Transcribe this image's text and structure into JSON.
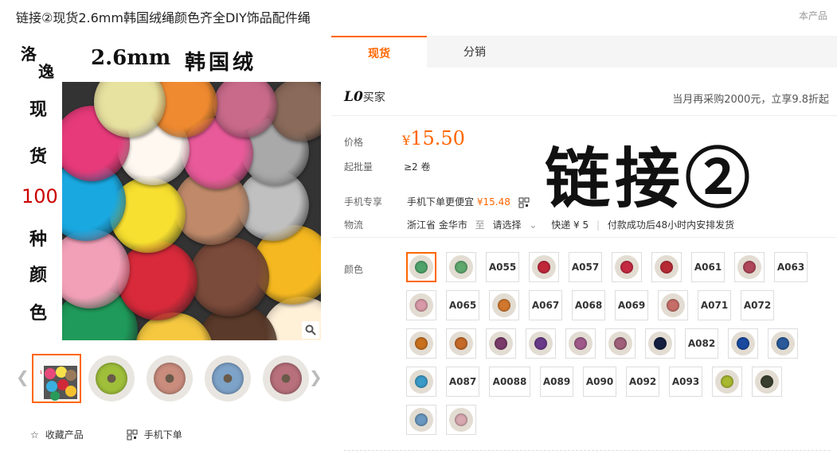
{
  "title": "链接②现货2.6mm韩国绒绳颜色齐全DIY饰品配件绳",
  "corner_label": "本产品",
  "main_image": {
    "brand_line1": "洛",
    "brand_line2": "逸",
    "size_text": "2.6mm",
    "material_text": "韩国绒",
    "side_chars": [
      "现",
      "货",
      "100",
      "种",
      "颜",
      "色"
    ],
    "zoom_icon": "magnifier-icon"
  },
  "thumbnails": {
    "prev_icon": "chevron-left-icon",
    "next_icon": "chevron-right-icon",
    "first_caption": "2.6mm 韩国绒",
    "colors": [
      "#9fbf3a",
      "#c98c7d",
      "#7ea3c9",
      "#b8707c"
    ]
  },
  "actions": {
    "favorite_label": "收藏产品",
    "mobile_order_label": "手机下单"
  },
  "tabs": [
    {
      "label": "现货",
      "active": true
    },
    {
      "label": "分销",
      "active": false
    }
  ],
  "buyer": {
    "badge": "L0",
    "label": "买家"
  },
  "promo_text": "当月再采购2000元，立享9.8折起",
  "price_row": {
    "label": "价格",
    "currency": "¥",
    "amount": "15.50"
  },
  "moq_row": {
    "label": "起批量",
    "value": "≥2 卷"
  },
  "mobile_row": {
    "label": "手机专享",
    "text": "手机下单更便宜",
    "price": "¥15.48"
  },
  "logistics_row": {
    "label": "物流",
    "origin": "浙江省 金华市",
    "to": "至",
    "destination": "请选择",
    "express": "快递 ¥ 5",
    "shipping_note": "付款成功后48小时内安排发货"
  },
  "overlay_text": "链接②",
  "color_label": "颜色",
  "swatches": [
    {
      "type": "img",
      "color": "#4fa36a",
      "selected": true
    },
    {
      "type": "img",
      "color": "#5fa86e"
    },
    {
      "type": "text",
      "label": "A055"
    },
    {
      "type": "img",
      "color": "#c0283a"
    },
    {
      "type": "text",
      "label": "A057"
    },
    {
      "type": "img",
      "color": "#c42a42"
    },
    {
      "type": "img",
      "color": "#b82b34"
    },
    {
      "type": "text",
      "label": "A061"
    },
    {
      "type": "img",
      "color": "#b0485a"
    },
    {
      "type": "text",
      "label": "A063"
    },
    {
      "type": "img",
      "color": "#d89aa8"
    },
    {
      "type": "text",
      "label": "A065"
    },
    {
      "type": "img",
      "color": "#d2782e"
    },
    {
      "type": "text",
      "label": "A067"
    },
    {
      "type": "text",
      "label": "A068"
    },
    {
      "type": "text",
      "label": "A069"
    },
    {
      "type": "img",
      "color": "#c76e68"
    },
    {
      "type": "text",
      "label": "A071"
    },
    {
      "type": "text",
      "label": "A072"
    },
    {
      "type": "img",
      "color": "#c8701e"
    },
    {
      "type": "img",
      "color": "#c56a28"
    },
    {
      "type": "img",
      "color": "#7a3a6a"
    },
    {
      "type": "img",
      "color": "#6a3a8a"
    },
    {
      "type": "img",
      "color": "#a05a8a"
    },
    {
      "type": "img",
      "color": "#a0607a"
    },
    {
      "type": "img",
      "color": "#152040"
    },
    {
      "type": "text",
      "label": "A082"
    },
    {
      "type": "img",
      "color": "#1a4aa0"
    },
    {
      "type": "img",
      "color": "#2a5a9a"
    },
    {
      "type": "img",
      "color": "#3a9ac8"
    },
    {
      "type": "text",
      "label": "A087"
    },
    {
      "type": "text",
      "label": "A0088"
    },
    {
      "type": "text",
      "label": "A089"
    },
    {
      "type": "text",
      "label": "A090"
    },
    {
      "type": "text",
      "label": "A092"
    },
    {
      "type": "text",
      "label": "A093"
    },
    {
      "type": "img",
      "color": "#a8b830"
    },
    {
      "type": "img",
      "color": "#3a4030"
    },
    {
      "type": "img",
      "color": "#6a98c0"
    },
    {
      "type": "img",
      "color": "#d8a8b0"
    }
  ]
}
